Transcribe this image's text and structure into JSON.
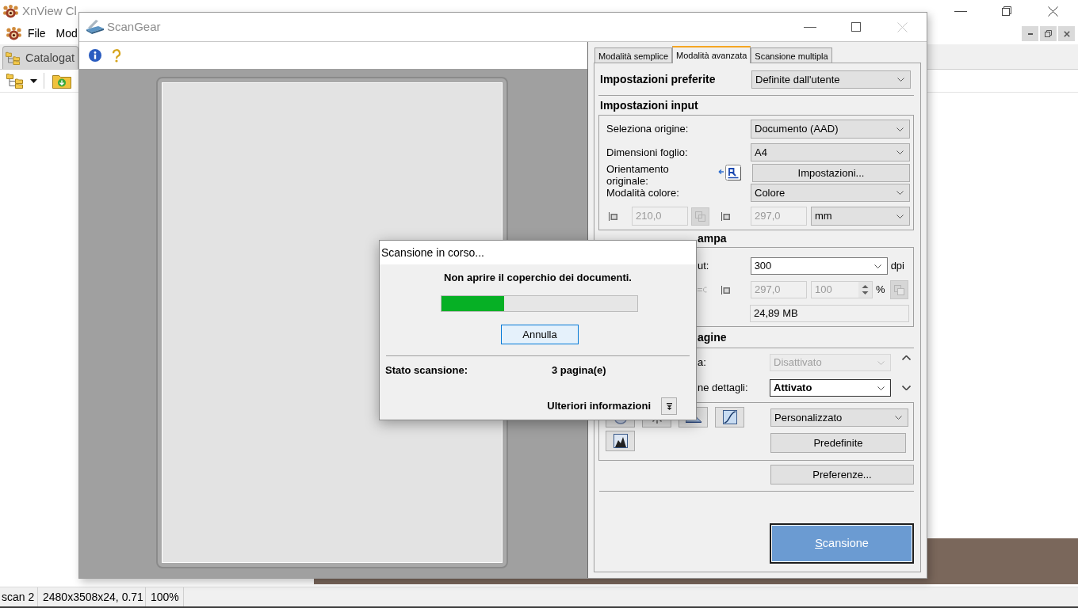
{
  "xnview": {
    "title": "XnView Cl",
    "menu": [
      "File",
      "Mod"
    ],
    "tabs": [
      {
        "label": "Catalogat",
        "selected": true
      }
    ],
    "status_bar": [
      "scan 2",
      "2480x3508x24, 0.71",
      "100%"
    ]
  },
  "scangear": {
    "title": "ScanGear",
    "tabs": [
      {
        "label": "Modalità semplice",
        "selected": false
      },
      {
        "label": "Modalità avanzata",
        "selected": true
      },
      {
        "label": "Scansione multipla",
        "selected": false
      }
    ],
    "favorite_settings": {
      "label": "Impostazioni preferite",
      "value": "Definite dall'utente"
    },
    "input_settings": {
      "heading": "Impostazioni input",
      "source": {
        "label": "Seleziona origine:",
        "value": "Documento (AAD)"
      },
      "paper_size": {
        "label": "Dimensioni foglio:",
        "value": "A4"
      },
      "orientation": {
        "label": "Orientamento originale:",
        "button": "Impostazioni..."
      },
      "color_mode": {
        "label": "Modalità colore:",
        "value": "Colore"
      },
      "width": {
        "value": "210,0",
        "disabled": true
      },
      "height": {
        "value": "297,0",
        "disabled": true
      },
      "unit": "mm"
    },
    "output_settings": {
      "heading": "ampa",
      "resolution": {
        "label": "ut:",
        "value": "300",
        "unit": "dpi"
      },
      "height": {
        "value": "297,0",
        "disabled": true
      },
      "scale": {
        "value": "100",
        "unit": "%",
        "disabled": true
      },
      "data_size": "24,89 MB"
    },
    "image_settings": {
      "heading": "agine",
      "rows": [
        {
          "label": "a:",
          "value": "Disattivato",
          "disabled": true
        },
        {
          "label": "ne dettagli:",
          "value": "Attivato",
          "disabled": false
        }
      ]
    },
    "color_adjustment": {
      "tone_preset": "Personalizzato",
      "defaults_button": "Predefinite"
    },
    "preferences_button": "Preferenze...",
    "scan_button": "Scansione"
  },
  "dialog": {
    "title": "Scansione in corso...",
    "message": "Non aprire il coperchio dei documenti.",
    "progress": {
      "level": 0.32
    },
    "cancel_button": "Annulla",
    "status": {
      "label": "Stato scansione:",
      "value": "3 pagina(e)"
    },
    "more_info": "Ulteriori informazioni"
  }
}
